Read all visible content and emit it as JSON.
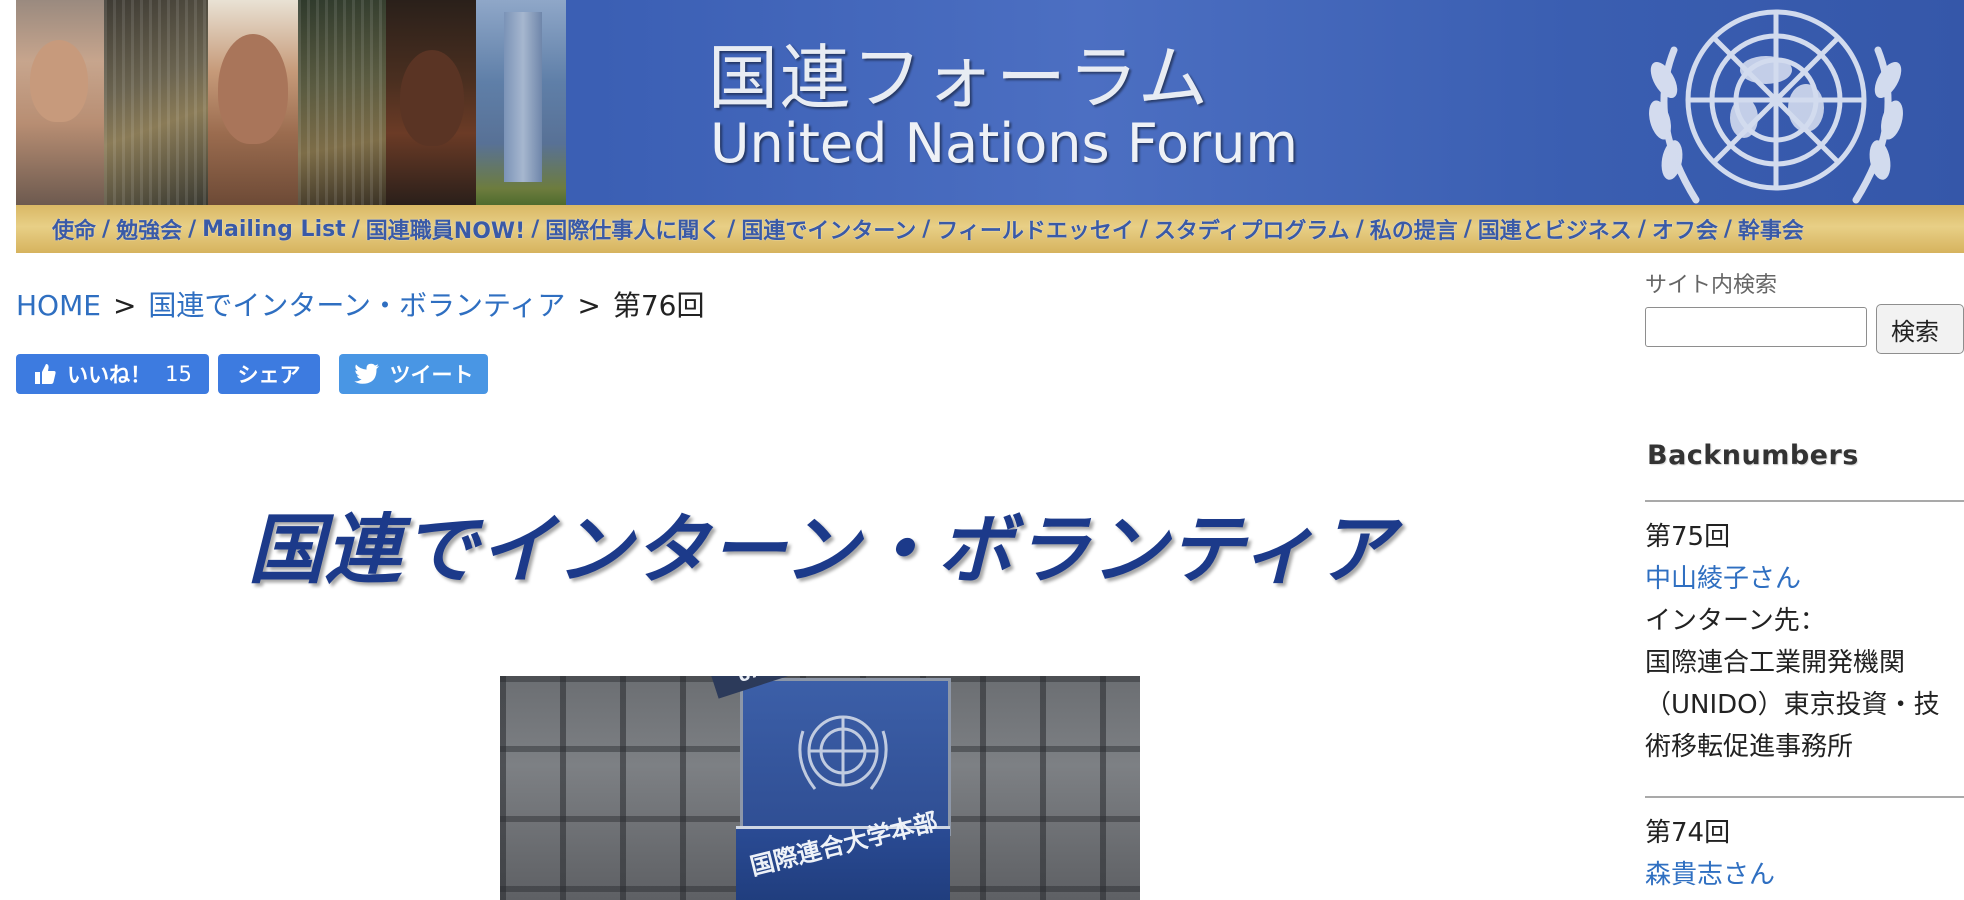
{
  "header": {
    "title_ja": "国連フォーラム",
    "title_en": "United Nations Forum",
    "nav": [
      "使命",
      "勉強会",
      "Mailing List",
      "国連職員NOW!",
      "国際仕事人に聞く",
      "国連でインターン",
      "フィールドエッセイ",
      "スタディプログラム",
      "私の提言",
      "国連とビジネス",
      "オフ会",
      "幹事会"
    ],
    "building_sign": "国際連合大学本部",
    "building_sign_top": "United"
  },
  "breadcrumb": {
    "home": "HOME",
    "section": "国連でインターン・ボランティア",
    "current": "第76回",
    "separator": ">"
  },
  "social": {
    "like_label": "いいね！",
    "like_count": "15",
    "share_label": "シェア",
    "tweet_label": "ツイート"
  },
  "main": {
    "heading": "国連でインターン・ボランティア"
  },
  "sidebar": {
    "search_label": "サイト内検索",
    "search_value": "",
    "search_button": "検索",
    "backnumbers_title": "Backnumbers",
    "entries": [
      {
        "number": "第75回",
        "name": "中山綾子さん",
        "place_label": "インターン先：",
        "place": "国際連合工業開発機関（UNIDO）東京投資・技術移転促進事務所"
      },
      {
        "number": "第74回",
        "name": "森貴志さん"
      }
    ]
  },
  "colors": {
    "link": "#2f6fc1",
    "facebook_button": "#3d7be0",
    "twitter_button": "#4996e4",
    "banner_blue": "#3f62b6",
    "nav_bar_gold": "#e8cf86",
    "heading_blue": "#1c3a8a"
  }
}
